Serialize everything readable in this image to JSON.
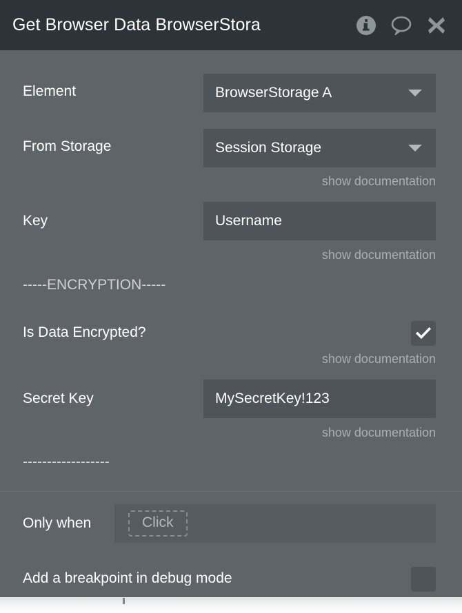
{
  "window": {
    "title": "Get Browser Data BrowserStora",
    "icons": [
      {
        "name": "info-icon",
        "glyph": "info"
      },
      {
        "name": "comment-icon",
        "glyph": "speech-bubble"
      },
      {
        "name": "close-icon",
        "glyph": "x"
      }
    ]
  },
  "colors": {
    "titlebar_bg": "#2d3439",
    "panel_bg": "#5e6468",
    "field_bg": "#4e5458",
    "text": "#ffffff",
    "muted_text": "#a9afb2",
    "icon": "#8d979b",
    "separator_text": "#cdd1d3"
  },
  "form": {
    "element": {
      "label": "Element",
      "value": "BrowserStorage A",
      "type": "dropdown"
    },
    "from_storage": {
      "label": "From Storage",
      "value": "Session Storage",
      "type": "dropdown",
      "doc_link": "show documentation"
    },
    "key": {
      "label": "Key",
      "value": "Username",
      "type": "text",
      "doc_link": "show documentation"
    },
    "encryption_separator": "-----ENCRYPTION-----",
    "is_encrypted": {
      "label": "Is Data Encrypted?",
      "checked": true,
      "doc_link": "show documentation"
    },
    "secret_key": {
      "label": "Secret Key",
      "value": "MySecretKey!123",
      "type": "text",
      "doc_link": "show documentation"
    },
    "bottom_separator": "------------------"
  },
  "footer": {
    "only_when": {
      "label": "Only when",
      "chip": "Click"
    },
    "breakpoint": {
      "label": "Add a breakpoint in debug mode",
      "checked": false
    }
  }
}
